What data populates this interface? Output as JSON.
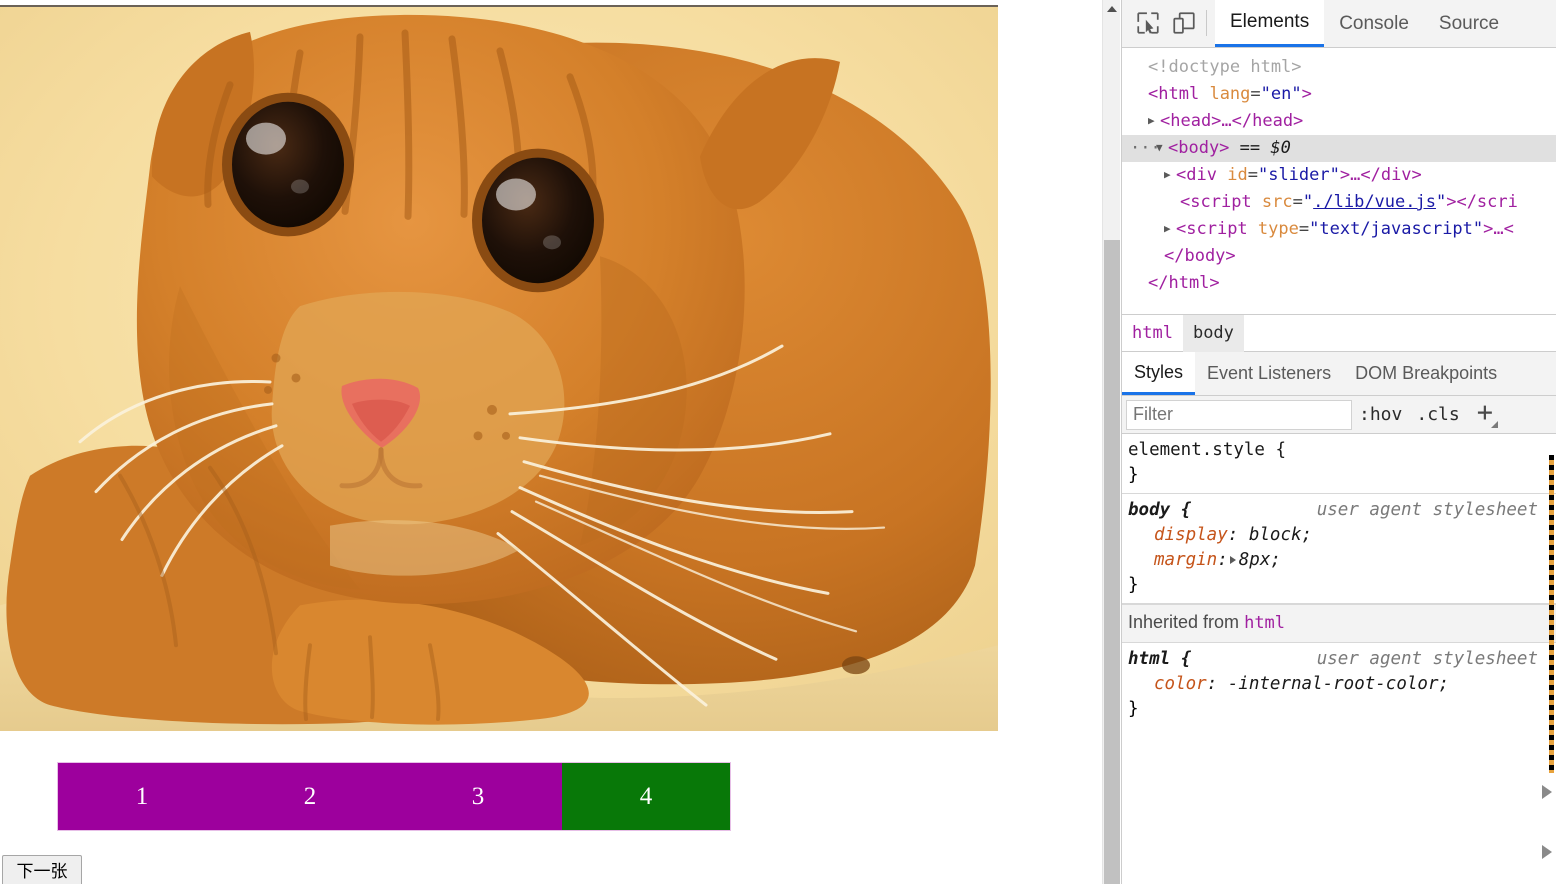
{
  "page": {
    "photo": {
      "alt_description": "close-up photo of an orange tabby cat lying down",
      "bg_color": "#f3d89a",
      "fur_color": "#d4802a"
    },
    "slider": {
      "segments": [
        {
          "label": "1",
          "color": "#9d009d",
          "state": "inactive"
        },
        {
          "label": "2",
          "color": "#9d009d",
          "state": "inactive"
        },
        {
          "label": "3",
          "color": "#9d009d",
          "state": "inactive"
        },
        {
          "label": "4",
          "color": "#087808",
          "state": "active"
        }
      ]
    },
    "next_button_label": "下一张",
    "scrollbar": {
      "up_arrow_icon": "chevron-up-icon"
    }
  },
  "devtools": {
    "toolbar": {
      "inspect_icon": "inspect-element-icon",
      "device_icon": "device-toolbar-icon",
      "tabs": [
        {
          "label": "Elements",
          "active": true
        },
        {
          "label": "Console",
          "active": false
        },
        {
          "label": "Source",
          "active": false
        }
      ]
    },
    "dom_tree": {
      "lines": [
        {
          "id": "doctype",
          "text": "<!doctype html>"
        },
        {
          "id": "html-open",
          "tag": "html",
          "attr": "lang",
          "value": "en"
        },
        {
          "id": "head",
          "text": "<head>…</head>"
        },
        {
          "id": "body",
          "text": "<body>",
          "suffix": "== $0",
          "selected": true
        },
        {
          "id": "div-slider",
          "tag": "div",
          "attr": "id",
          "value": "slider",
          "close": "…</div>"
        },
        {
          "id": "script-vue",
          "tag": "script",
          "attr": "src",
          "value": "./lib/vue.js",
          "close": "></scri"
        },
        {
          "id": "script-inline",
          "tag": "script",
          "attr": "type",
          "value": "text/javascript",
          "close": ">…<"
        },
        {
          "id": "body-close",
          "text": "</body>"
        },
        {
          "id": "html-close",
          "text": "</html>"
        }
      ]
    },
    "breadcrumb": [
      {
        "label": "html",
        "active": false
      },
      {
        "label": "body",
        "active": true
      }
    ],
    "sidebar_tabs": [
      {
        "label": "Styles",
        "active": true
      },
      {
        "label": "Event Listeners",
        "active": false
      },
      {
        "label": "DOM Breakpoints",
        "active": false
      }
    ],
    "filter": {
      "placeholder": "Filter",
      "value": "",
      "hov_label": ":hov",
      "cls_label": ".cls",
      "new_rule_label": "+"
    },
    "style_rules": [
      {
        "id": "element-style",
        "selector": "element.style",
        "open": "{",
        "close": "}",
        "origin": "",
        "declarations": []
      },
      {
        "id": "body-ua",
        "selector": "body",
        "open": "{",
        "close": "}",
        "origin": "user agent stylesheet",
        "declarations": [
          {
            "property": "display",
            "value": "block;",
            "expandable": false
          },
          {
            "property": "margin",
            "value": "8px;",
            "expandable": true
          }
        ]
      }
    ],
    "inherited_header": {
      "prefix": "Inherited from",
      "source": "html"
    },
    "inherited_rules": [
      {
        "id": "html-ua",
        "selector": "html",
        "open": "{",
        "close": "}",
        "origin": "user agent stylesheet",
        "declarations": [
          {
            "property": "color",
            "value": "-internal-root-color;",
            "expandable": false
          }
        ]
      }
    ],
    "accent_color": "#1a73e8"
  }
}
